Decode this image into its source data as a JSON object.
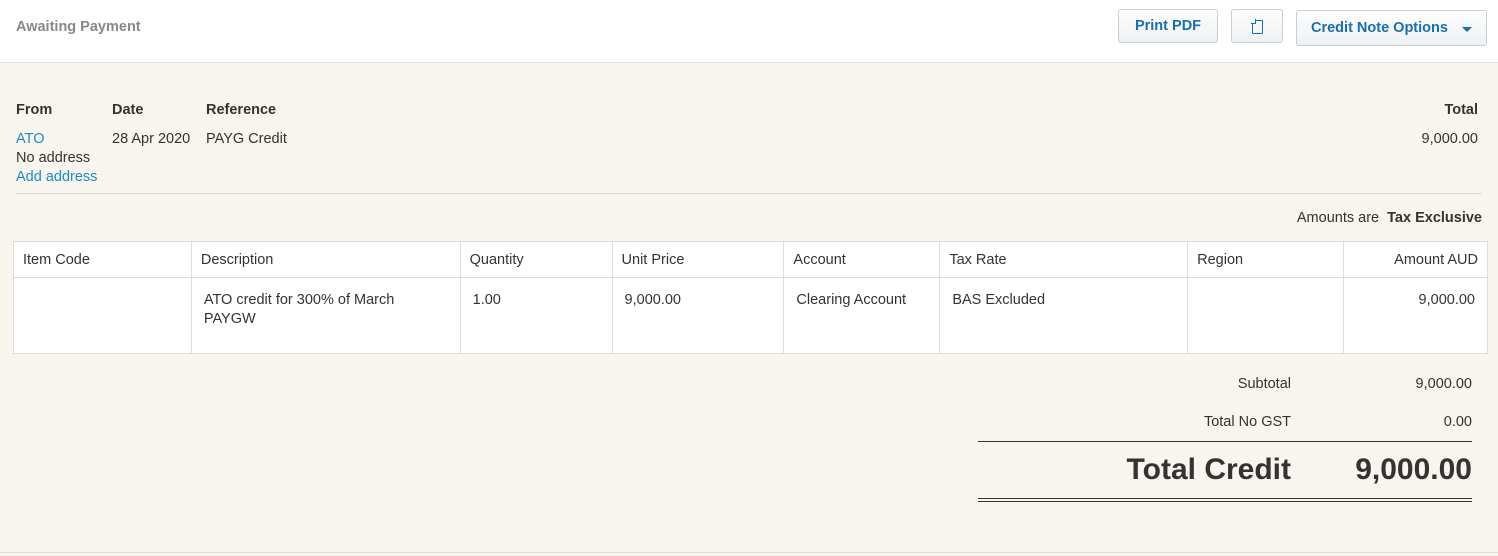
{
  "status": "Awaiting Payment",
  "toolbar": {
    "print_label": "Print PDF",
    "copy_icon": "copy-icon",
    "options_label": "Credit Note Options"
  },
  "header": {
    "from_label": "From",
    "date_label": "Date",
    "reference_label": "Reference",
    "total_label": "Total",
    "from_name": "ATO",
    "no_address": "No address",
    "add_address": "Add address",
    "date": "28 Apr 2020",
    "reference": "PAYG Credit",
    "total": "9,000.00"
  },
  "amounts": {
    "prefix": "Amounts are",
    "mode": "Tax Exclusive"
  },
  "table": {
    "columns": [
      "Item Code",
      "Description",
      "Quantity",
      "Unit Price",
      "Account",
      "Tax Rate",
      "Region",
      "Amount AUD"
    ],
    "rows": [
      {
        "item_code": "",
        "description": "ATO credit for 300% of March PAYGW",
        "quantity": "1.00",
        "unit_price": "9,000.00",
        "account": "Clearing Account",
        "tax_rate": "BAS Excluded",
        "region": "",
        "amount": "9,000.00"
      }
    ]
  },
  "totals": {
    "subtotal_label": "Subtotal",
    "subtotal": "9,000.00",
    "tax_label": "Total No GST",
    "tax": "0.00",
    "total_label": "Total Credit",
    "total": "9,000.00"
  },
  "colors": {
    "accent": "#1b6fa8",
    "link": "#1b8bc6",
    "background": "#f8f4ee"
  }
}
